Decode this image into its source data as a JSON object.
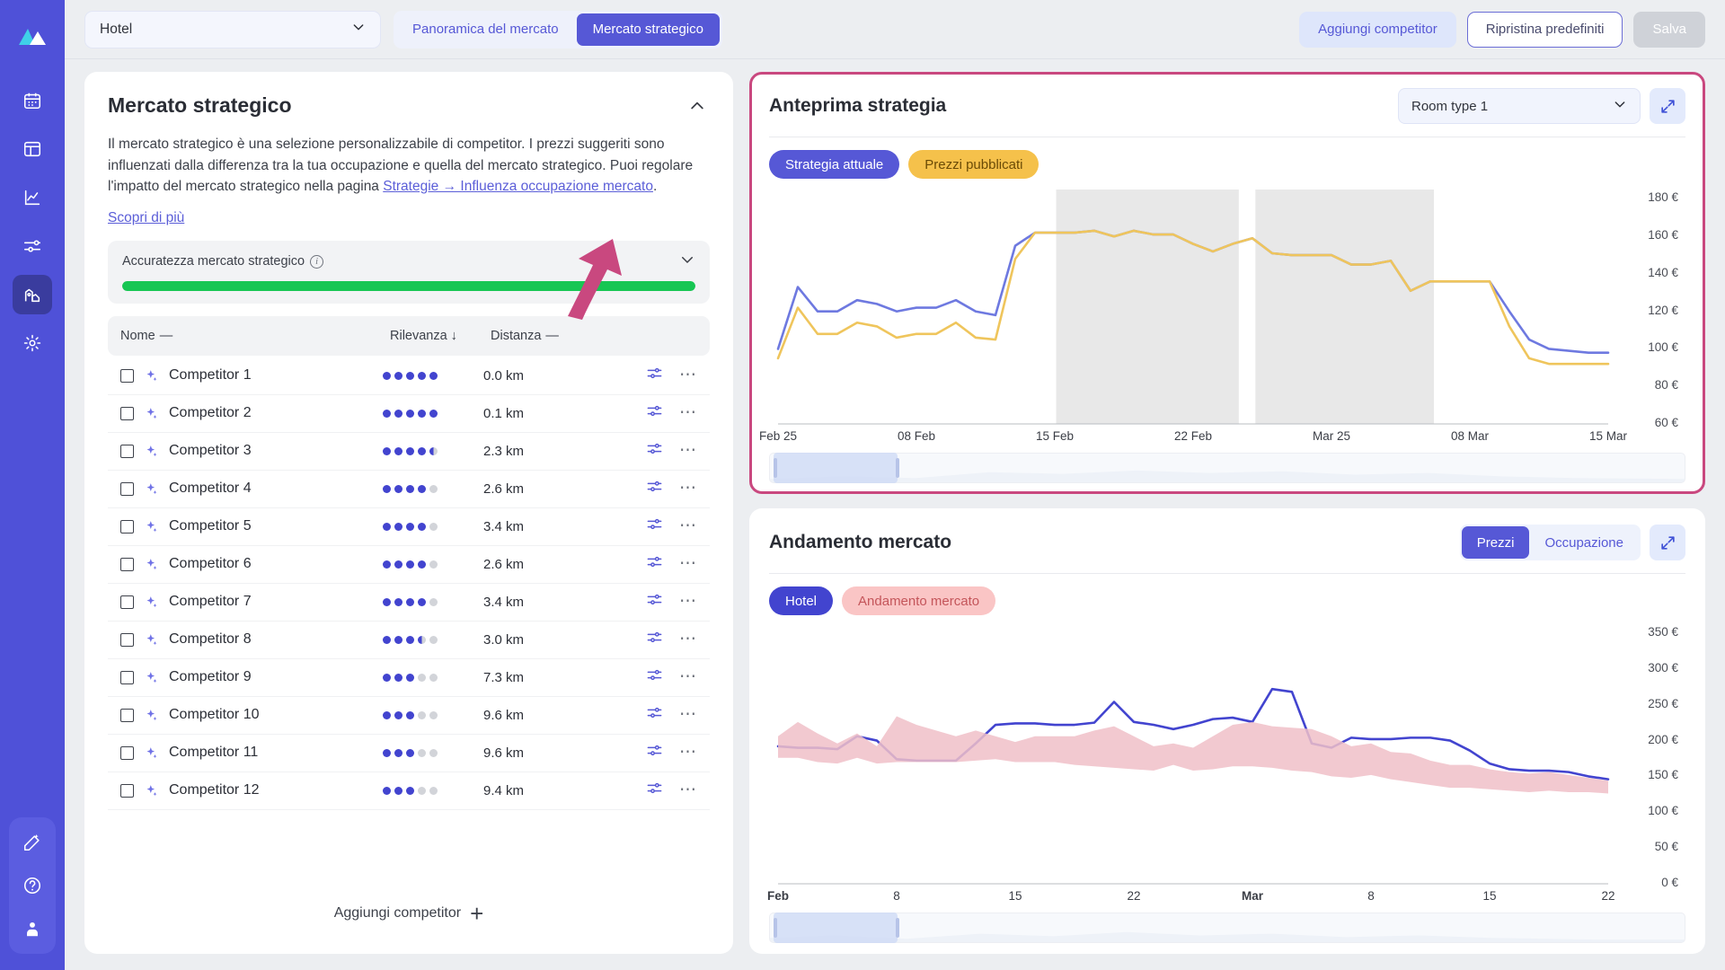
{
  "sidebar": {
    "logo_icon": "mountain-logo-icon",
    "items": [
      {
        "icon": "calendar-icon",
        "name": "calendar",
        "active": false
      },
      {
        "icon": "dashboard-icon",
        "name": "dashboard",
        "active": false
      },
      {
        "icon": "chart-line-icon",
        "name": "performance",
        "active": false
      },
      {
        "icon": "sliders-icon",
        "name": "strategies",
        "active": false
      },
      {
        "icon": "market-icon",
        "name": "market",
        "active": true
      },
      {
        "icon": "gear-icon",
        "name": "settings",
        "active": false
      }
    ],
    "bottom_items": [
      {
        "icon": "magic-wand-icon",
        "name": "assistant"
      },
      {
        "icon": "help-circle-icon",
        "name": "help"
      },
      {
        "icon": "user-icon",
        "name": "account"
      }
    ]
  },
  "topbar": {
    "property_value": "Hotel",
    "tabs": [
      {
        "label": "Panoramica del mercato",
        "active": false
      },
      {
        "label": "Mercato strategico",
        "active": true
      }
    ],
    "add_competitor_label": "Aggiungi competitor",
    "reset_label": "Ripristina predefiniti",
    "save_label": "Salva"
  },
  "left_panel": {
    "title": "Mercato strategico",
    "description_part1": "Il mercato strategico è una selezione personalizzabile di competitor. I prezzi suggeriti sono influenzati dalla differenza tra la tua occupazione e quella del mercato strategico. Puoi regolare l'impatto del mercato strategico nella pagina ",
    "description_link": "Strategie → Influenza occupazione mercato",
    "description_part2": ".",
    "learn_more": "Scopri di più",
    "accuracy_label": "Accuratezza mercato strategico",
    "accuracy_percent": 100,
    "columns": {
      "name": "Nome",
      "name_sort": "—",
      "relevance": "Rilevanza",
      "relevance_sort": "↓",
      "distance": "Distanza",
      "distance_sort": "—"
    },
    "rows": [
      {
        "name": "Competitor 1",
        "relevance": 5.0,
        "distance": "0.0 km"
      },
      {
        "name": "Competitor  2",
        "relevance": 5.0,
        "distance": "0.1 km"
      },
      {
        "name": "Competitor 3",
        "relevance": 4.5,
        "distance": "2.3 km"
      },
      {
        "name": "Competitor  4",
        "relevance": 4.0,
        "distance": "2.6 km"
      },
      {
        "name": "Competitor 5",
        "relevance": 4.0,
        "distance": "3.4 km"
      },
      {
        "name": "Competitor  6",
        "relevance": 4.0,
        "distance": "2.6 km"
      },
      {
        "name": "Competitor  7",
        "relevance": 4.0,
        "distance": "3.4 km"
      },
      {
        "name": "Competitor  8",
        "relevance": 3.5,
        "distance": "3.0 km"
      },
      {
        "name": "Competitor 9",
        "relevance": 3.0,
        "distance": "7.3 km"
      },
      {
        "name": "Competitor 10",
        "relevance": 3.0,
        "distance": "9.6 km"
      },
      {
        "name": "Competitor 11",
        "relevance": 3.0,
        "distance": "9.6 km"
      },
      {
        "name": "Competitor 12",
        "relevance": 3.0,
        "distance": "9.4 km"
      }
    ],
    "add_competitor_label": "Aggiungi competitor"
  },
  "strategy_card": {
    "title": "Anteprima strategia",
    "room_type": "Room type 1",
    "expand_icon": "expand-icon",
    "legend": [
      {
        "label": "Strategia attuale",
        "color": "#5658d6"
      },
      {
        "label": "Prezzi pubblicati",
        "color": "#f5c14b"
      }
    ]
  },
  "market_card": {
    "title": "Andamento mercato",
    "toggles": [
      {
        "label": "Prezzi",
        "active": true
      },
      {
        "label": "Occupazione",
        "active": false
      }
    ],
    "expand_icon": "expand-icon",
    "legend": [
      {
        "label": "Hotel",
        "color": "#4244cf"
      },
      {
        "label": "Andamento mercato",
        "color": "#fac5c5"
      }
    ]
  },
  "chart_data": [
    {
      "id": "strategy-preview-chart",
      "type": "line",
      "title": "Anteprima strategia",
      "xlabel": "",
      "ylabel": "",
      "ylim": [
        60,
        185
      ],
      "yticks": [
        "180 €",
        "160 €",
        "140 €",
        "120 €",
        "100 €",
        "80 €",
        "60 €"
      ],
      "ytick_values": [
        180,
        160,
        140,
        120,
        100,
        80,
        60
      ],
      "xticks": [
        "Feb 25",
        "08 Feb",
        "15 Feb",
        "22 Feb",
        "Mar 25",
        "08 Mar",
        "15 Mar"
      ],
      "grid": false,
      "legend_position": "top-left",
      "shaded_bands": [
        [
          0.335,
          0.555
        ],
        [
          0.575,
          0.79
        ]
      ],
      "series": [
        {
          "name": "Strategia attuale",
          "color": "#6e79e0",
          "values": [
            100,
            133,
            120,
            120,
            126,
            124,
            120,
            122,
            122,
            126,
            120,
            118,
            155,
            162,
            162,
            162,
            163,
            160,
            163,
            161,
            161,
            156,
            152,
            156,
            159,
            151,
            150,
            150,
            150,
            145,
            145,
            147,
            131,
            136,
            136,
            136,
            136,
            120,
            105,
            100,
            99,
            98,
            98
          ]
        },
        {
          "name": "Prezzi pubblicati",
          "color": "#efc55c",
          "values": [
            95,
            122,
            108,
            108,
            114,
            112,
            106,
            108,
            108,
            114,
            106,
            105,
            148,
            162,
            162,
            162,
            163,
            160,
            163,
            161,
            161,
            156,
            152,
            156,
            159,
            151,
            150,
            150,
            150,
            145,
            145,
            147,
            131,
            136,
            136,
            136,
            136,
            112,
            95,
            92,
            92,
            92,
            92
          ]
        }
      ],
      "brush": {
        "window_start": 0.005,
        "window_width": 0.135
      }
    },
    {
      "id": "market-trend-chart",
      "type": "area-line",
      "title": "Andamento mercato",
      "xlabel": "",
      "ylabel": "",
      "ylim": [
        0,
        360
      ],
      "yticks": [
        "350 €",
        "300 €",
        "250 €",
        "200 €",
        "150 €",
        "100 €",
        "50 €",
        "0 €"
      ],
      "ytick_values": [
        350,
        300,
        250,
        200,
        150,
        100,
        50,
        0
      ],
      "xticks": [
        "Feb",
        "8",
        "15",
        "22",
        "Mar",
        "8",
        "15",
        "22"
      ],
      "grid": false,
      "legend_position": "top-left",
      "series": [
        {
          "name": "Hotel",
          "type": "line",
          "color": "#4244cf",
          "values": [
            192,
            190,
            190,
            188,
            206,
            200,
            174,
            172,
            172,
            172,
            196,
            222,
            224,
            224,
            222,
            222,
            225,
            254,
            226,
            222,
            216,
            222,
            230,
            232,
            226,
            272,
            268,
            196,
            190,
            204,
            202,
            202,
            204,
            204,
            200,
            186,
            168,
            160,
            158,
            158,
            156,
            150,
            146
          ]
        },
        {
          "name": "Andamento mercato",
          "type": "band",
          "color": "#f0c0c8",
          "upper": [
            206,
            226,
            210,
            196,
            210,
            192,
            234,
            222,
            214,
            206,
            214,
            206,
            198,
            206,
            206,
            206,
            214,
            220,
            206,
            192,
            196,
            190,
            206,
            222,
            226,
            220,
            218,
            216,
            206,
            192,
            196,
            184,
            182,
            172,
            166,
            166,
            160,
            156,
            154,
            156,
            152,
            148,
            144
          ],
          "lower": [
            176,
            176,
            170,
            168,
            176,
            168,
            170,
            170,
            170,
            170,
            172,
            174,
            170,
            170,
            170,
            166,
            164,
            162,
            160,
            158,
            166,
            158,
            160,
            164,
            164,
            162,
            158,
            156,
            150,
            148,
            152,
            146,
            142,
            138,
            134,
            134,
            132,
            130,
            128,
            130,
            128,
            128,
            126
          ]
        }
      ],
      "brush": {
        "window_start": 0.005,
        "window_width": 0.135
      }
    }
  ]
}
